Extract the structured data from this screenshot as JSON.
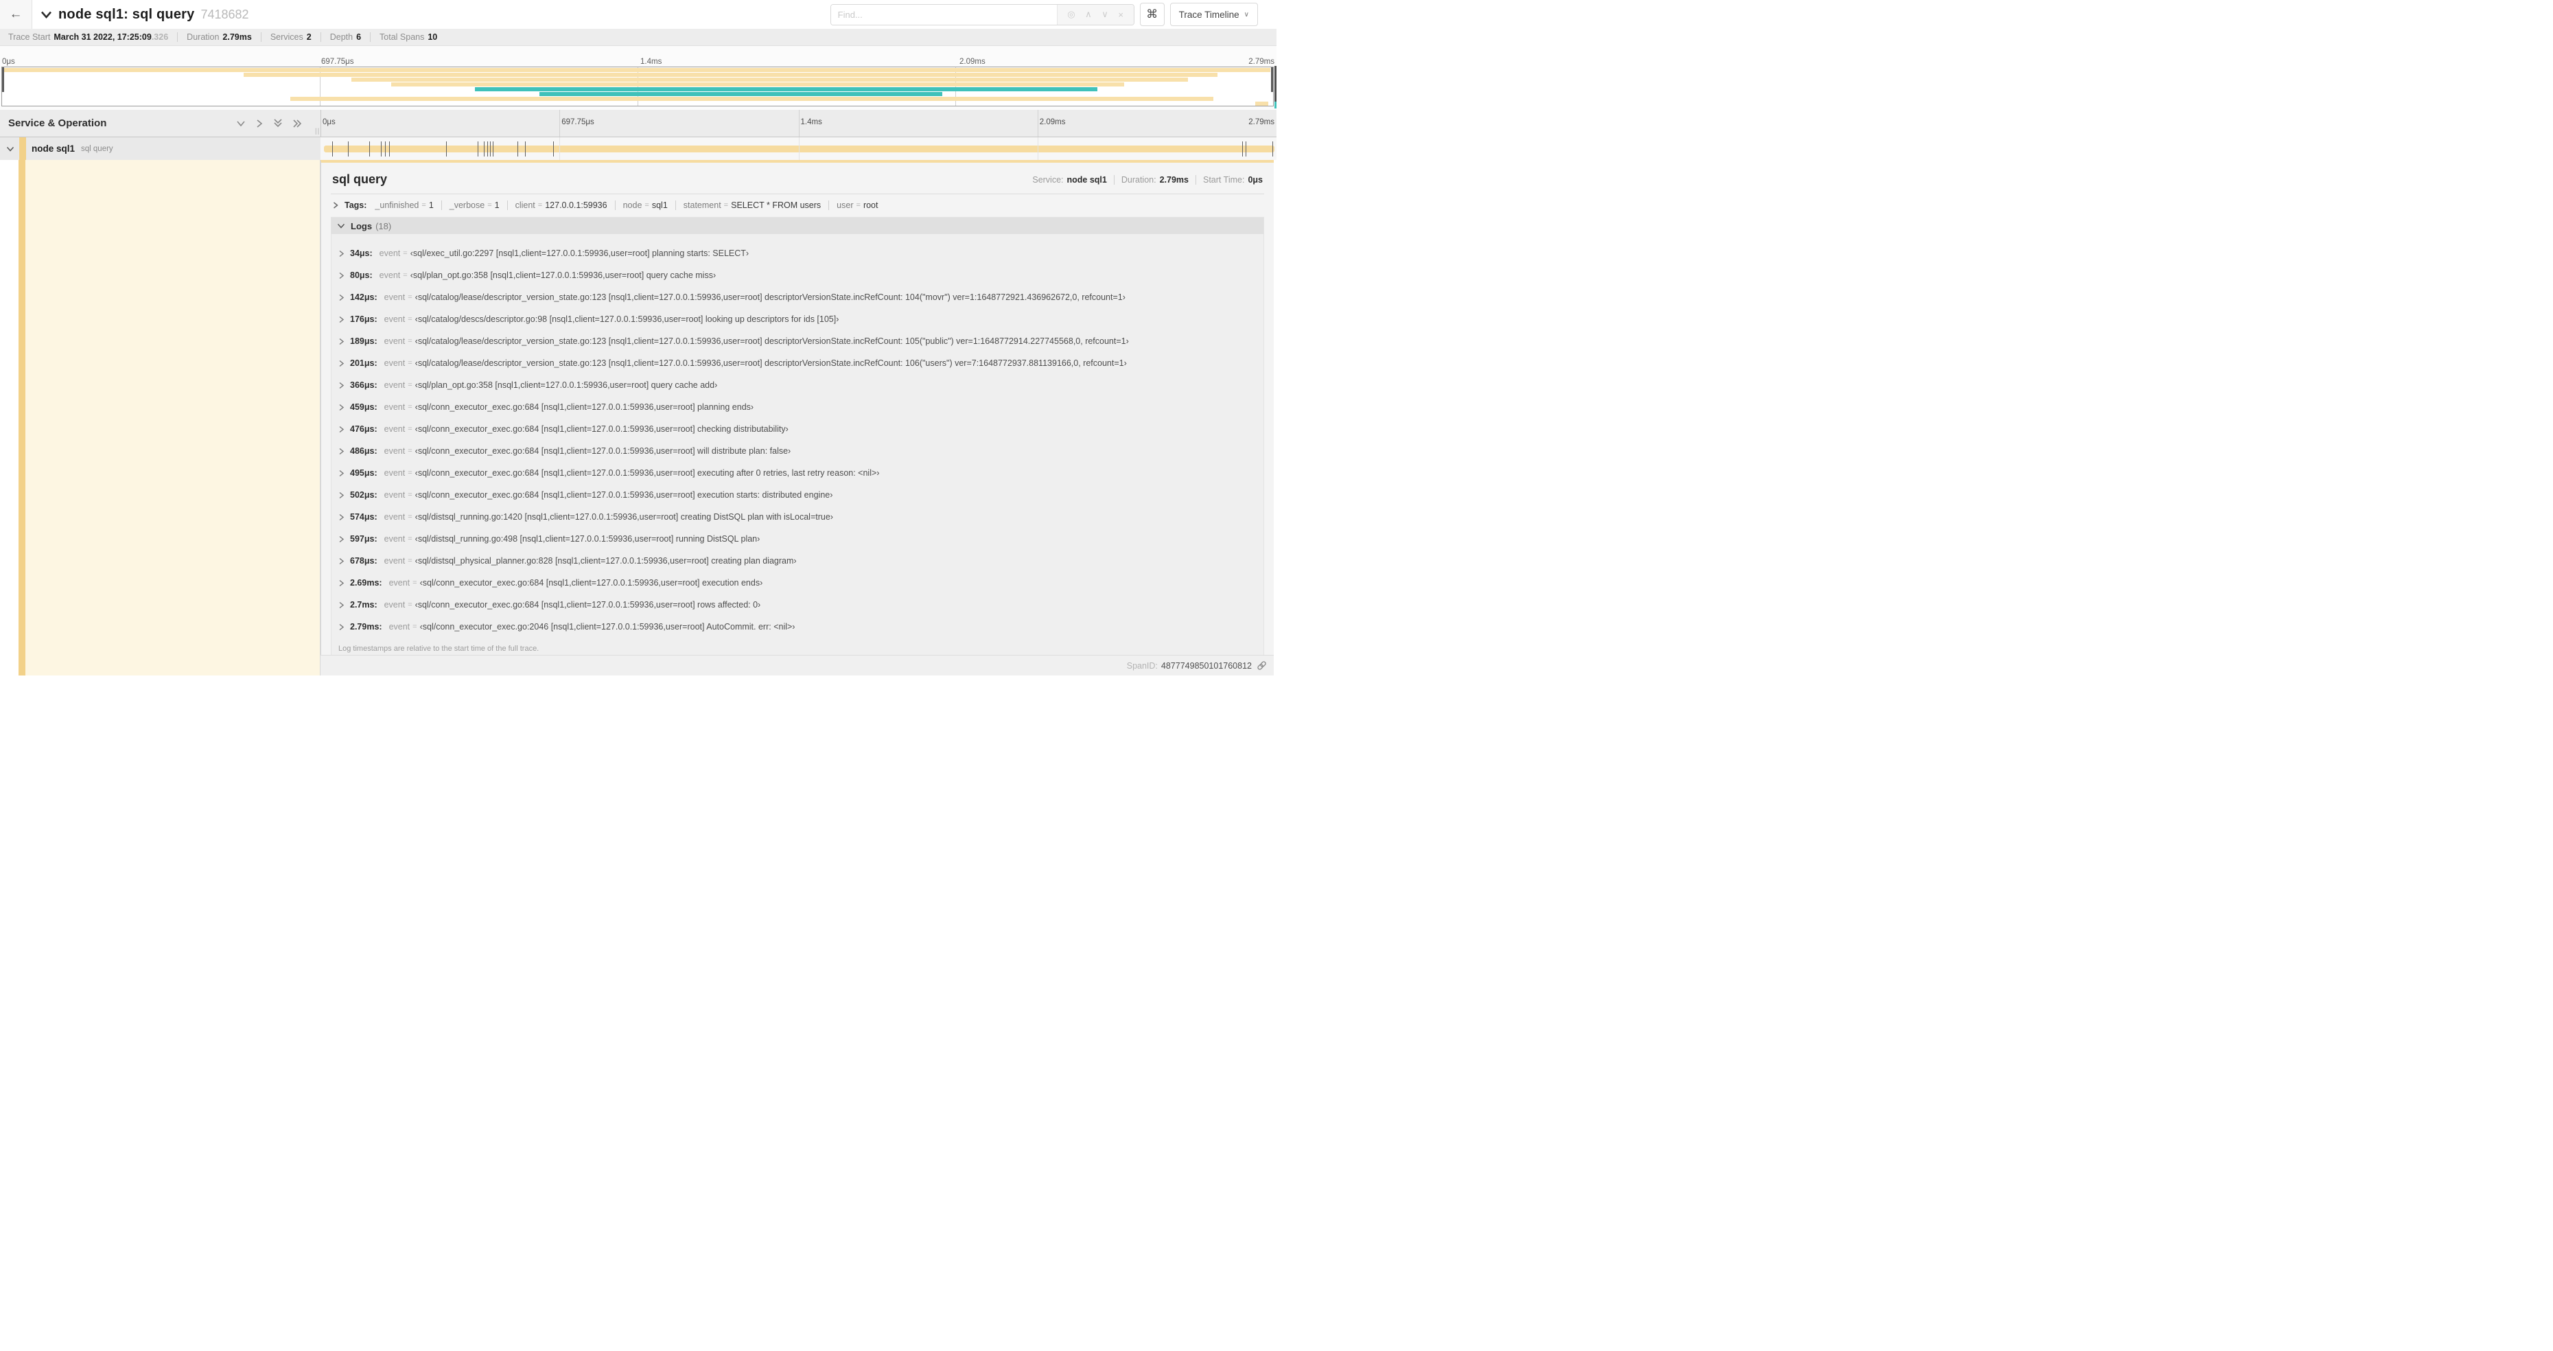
{
  "header": {
    "title": "node sql1: sql query",
    "trace_id_short": "7418682",
    "find_placeholder": "Find...",
    "shortcut_symbol": "⌘",
    "view_select_label": "Trace Timeline",
    "find_icons": {
      "locate": "◎",
      "prev": "∧",
      "next": "∨",
      "clear": "×"
    }
  },
  "summary": {
    "items": [
      {
        "label": "Trace Start",
        "value": "March 31 2022, 17:25:09",
        "suffix": ".326"
      },
      {
        "label": "Duration",
        "value": "2.79ms"
      },
      {
        "label": "Services",
        "value": "2"
      },
      {
        "label": "Depth",
        "value": "6"
      },
      {
        "label": "Total Spans",
        "value": "10"
      }
    ]
  },
  "timeline": {
    "ticks": [
      {
        "label": "0μs",
        "pos": 0
      },
      {
        "label": "697.75μs",
        "pos": 25
      },
      {
        "label": "1.4ms",
        "pos": 50
      },
      {
        "label": "2.09ms",
        "pos": 75
      },
      {
        "label": "2.79ms",
        "pos": 100
      }
    ],
    "gridlines": [
      25,
      50,
      75
    ],
    "colors": {
      "tan": "#f8e0aa",
      "teal": "#3fc1ba"
    },
    "minimap_rows": [
      {
        "s": 0,
        "e": 99.8,
        "c": "tan"
      },
      {
        "s": 19,
        "e": 95.6,
        "c": "tan"
      },
      {
        "s": 27.5,
        "e": 93.3,
        "c": "tan"
      },
      {
        "s": 30.6,
        "e": 88.3,
        "c": "tan"
      },
      {
        "s": 37.2,
        "e": 86.2,
        "c": "teal"
      },
      {
        "s": 42.3,
        "e": 74.0,
        "c": "teal"
      },
      {
        "s": 22.7,
        "e": 95.3,
        "c": "tan"
      },
      {
        "s": 98.6,
        "e": 99.6,
        "c": "tan"
      }
    ]
  },
  "left_panel": {
    "title": "Service & Operation",
    "service": "node sql1",
    "operation": "sql query",
    "grip": "||"
  },
  "span_bar": {
    "total_us": 2790,
    "ticks_us": [
      34,
      80,
      142,
      176,
      189,
      201,
      366,
      459,
      476,
      486,
      495,
      502,
      574,
      597,
      678,
      2690,
      2700,
      2790
    ]
  },
  "detail": {
    "title": "sql query",
    "meta": [
      {
        "label": "Service:",
        "value": "node sql1"
      },
      {
        "label": "Duration:",
        "value": "2.79ms"
      },
      {
        "label": "Start Time:",
        "value": "0μs"
      }
    ],
    "tags_label": "Tags:",
    "tags": [
      {
        "k": "_unfinished",
        "v": "1"
      },
      {
        "k": "_verbose",
        "v": "1"
      },
      {
        "k": "client",
        "v": "127.0.0.1:59936"
      },
      {
        "k": "node",
        "v": "sql1"
      },
      {
        "k": "statement",
        "v": "SELECT * FROM users"
      },
      {
        "k": "user",
        "v": "root"
      }
    ],
    "logs_label": "Logs",
    "logs_count": "(18)",
    "log_key": "event",
    "log_eq": "=",
    "logs": [
      {
        "time": "34μs:",
        "value": "‹sql/exec_util.go:2297 [nsql1,client=127.0.0.1:59936,user=root] planning starts: SELECT›"
      },
      {
        "time": "80μs:",
        "value": "‹sql/plan_opt.go:358 [nsql1,client=127.0.0.1:59936,user=root] query cache miss›"
      },
      {
        "time": "142μs:",
        "value": "‹sql/catalog/lease/descriptor_version_state.go:123 [nsql1,client=127.0.0.1:59936,user=root] descriptorVersionState.incRefCount: 104(\"movr\") ver=1:1648772921.436962672,0, refcount=1›"
      },
      {
        "time": "176μs:",
        "value": "‹sql/catalog/descs/descriptor.go:98 [nsql1,client=127.0.0.1:59936,user=root] looking up descriptors for ids [105]›"
      },
      {
        "time": "189μs:",
        "value": "‹sql/catalog/lease/descriptor_version_state.go:123 [nsql1,client=127.0.0.1:59936,user=root] descriptorVersionState.incRefCount: 105(\"public\") ver=1:1648772914.227745568,0, refcount=1›"
      },
      {
        "time": "201μs:",
        "value": "‹sql/catalog/lease/descriptor_version_state.go:123 [nsql1,client=127.0.0.1:59936,user=root] descriptorVersionState.incRefCount: 106(\"users\") ver=7:1648772937.881139166,0, refcount=1›"
      },
      {
        "time": "366μs:",
        "value": "‹sql/plan_opt.go:358 [nsql1,client=127.0.0.1:59936,user=root] query cache add›"
      },
      {
        "time": "459μs:",
        "value": "‹sql/conn_executor_exec.go:684 [nsql1,client=127.0.0.1:59936,user=root] planning ends›"
      },
      {
        "time": "476μs:",
        "value": "‹sql/conn_executor_exec.go:684 [nsql1,client=127.0.0.1:59936,user=root] checking distributability›"
      },
      {
        "time": "486μs:",
        "value": "‹sql/conn_executor_exec.go:684 [nsql1,client=127.0.0.1:59936,user=root] will distribute plan: false›"
      },
      {
        "time": "495μs:",
        "value": "‹sql/conn_executor_exec.go:684 [nsql1,client=127.0.0.1:59936,user=root] executing after 0 retries, last retry reason: <nil>›"
      },
      {
        "time": "502μs:",
        "value": "‹sql/conn_executor_exec.go:684 [nsql1,client=127.0.0.1:59936,user=root] execution starts: distributed engine›"
      },
      {
        "time": "574μs:",
        "value": "‹sql/distsql_running.go:1420 [nsql1,client=127.0.0.1:59936,user=root] creating DistSQL plan with isLocal=true›"
      },
      {
        "time": "597μs:",
        "value": "‹sql/distsql_running.go:498 [nsql1,client=127.0.0.1:59936,user=root] running DistSQL plan›"
      },
      {
        "time": "678μs:",
        "value": "‹sql/distsql_physical_planner.go:828 [nsql1,client=127.0.0.1:59936,user=root] creating plan diagram›"
      },
      {
        "time": "2.69ms:",
        "value": "‹sql/conn_executor_exec.go:684 [nsql1,client=127.0.0.1:59936,user=root] execution ends›"
      },
      {
        "time": "2.7ms:",
        "value": "‹sql/conn_executor_exec.go:684 [nsql1,client=127.0.0.1:59936,user=root] rows affected: 0›"
      },
      {
        "time": "2.79ms:",
        "value": "‹sql/conn_executor_exec.go:2046 [nsql1,client=127.0.0.1:59936,user=root] AutoCommit. err: <nil>›"
      }
    ],
    "logs_note": "Log timestamps are relative to the start time of the full trace.",
    "spanid_label": "SpanID:",
    "spanid": "4877749850101760812"
  }
}
